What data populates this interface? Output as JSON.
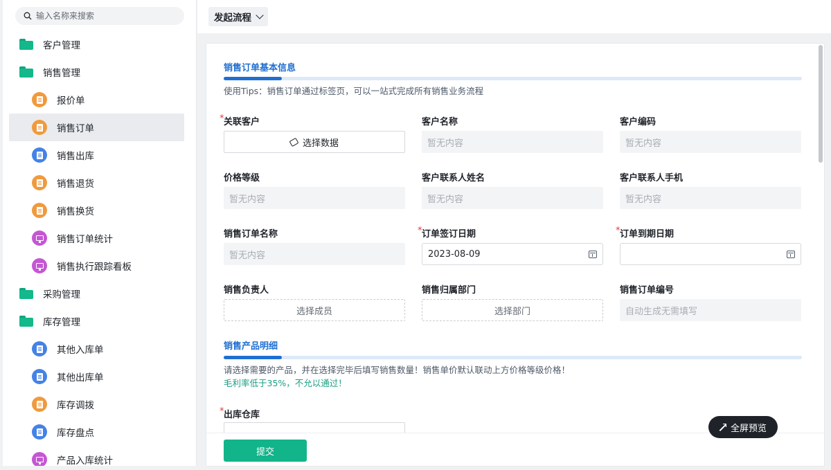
{
  "sidebar": {
    "search_placeholder": "输入名称来搜索",
    "items": [
      {
        "label": "客户管理",
        "type": "folder"
      },
      {
        "label": "销售管理",
        "type": "folder"
      },
      {
        "label": "报价单",
        "type": "child",
        "color": "orange"
      },
      {
        "label": "销售订单",
        "type": "child",
        "color": "orange",
        "active": true
      },
      {
        "label": "销售出库",
        "type": "child",
        "color": "blue"
      },
      {
        "label": "销售退货",
        "type": "child",
        "color": "orange"
      },
      {
        "label": "销售换货",
        "type": "child",
        "color": "orange"
      },
      {
        "label": "销售订单统计",
        "type": "child",
        "color": "purple"
      },
      {
        "label": "销售执行跟踪看板",
        "type": "child",
        "color": "purple"
      },
      {
        "label": "采购管理",
        "type": "folder"
      },
      {
        "label": "库存管理",
        "type": "folder"
      },
      {
        "label": "其他入库单",
        "type": "child",
        "color": "blue"
      },
      {
        "label": "其他出库单",
        "type": "child",
        "color": "blue"
      },
      {
        "label": "库存调拨",
        "type": "child",
        "color": "orange"
      },
      {
        "label": "库存盘点",
        "type": "child",
        "color": "blue"
      },
      {
        "label": "产品入库统计",
        "type": "child",
        "color": "purple"
      }
    ]
  },
  "topbar": {
    "flow_label": "发起流程"
  },
  "form": {
    "section1_title": "销售订单基本信息",
    "section1_tip": "使用Tips：销售订单通过标签页，可以一站式完成所有销售业务流程",
    "fields": {
      "customer_link": {
        "label": "关联客户",
        "button": "选择数据"
      },
      "customer_name": {
        "label": "客户名称",
        "value": "暂无内容"
      },
      "customer_code": {
        "label": "客户编码",
        "value": "暂无内容"
      },
      "price_level": {
        "label": "价格等级",
        "value": "暂无内容"
      },
      "contact_name": {
        "label": "客户联系人姓名",
        "value": "暂无内容"
      },
      "contact_phone": {
        "label": "客户联系人手机",
        "value": "暂无内容"
      },
      "order_name": {
        "label": "销售订单名称",
        "value": "暂无内容"
      },
      "sign_date": {
        "label": "订单签订日期",
        "value": "2023-08-09"
      },
      "due_date": {
        "label": "订单到期日期",
        "value": ""
      },
      "owner": {
        "label": "销售负责人",
        "button": "选择成员"
      },
      "department": {
        "label": "销售归属部门",
        "button": "选择部门"
      },
      "order_no": {
        "label": "销售订单编号",
        "value": "自动生成无需填写"
      },
      "warehouse": {
        "label": "出库仓库"
      }
    },
    "section2_title": "销售产品明细",
    "section2_tip1": "请选择需要的产品，并在选择完毕后填写销售数量！销售单价默认联动上方价格等级价格！",
    "section2_tip2": "毛利率低于35%，不允以通过！",
    "submit_label": "提交",
    "required_mark": "*"
  },
  "fullscreen_label": "全屏预览"
}
